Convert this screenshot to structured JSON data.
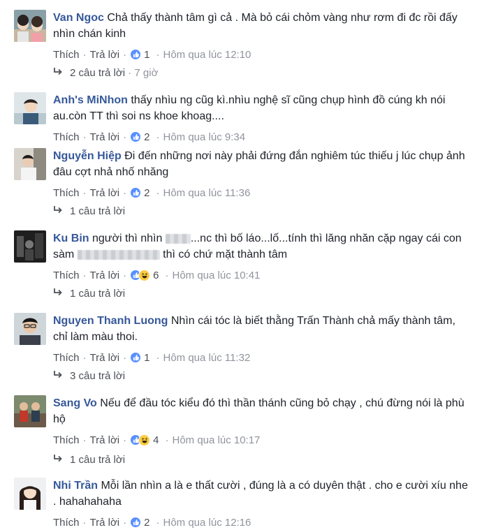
{
  "comments": [
    {
      "name": "Van Ngoc",
      "text_1": "Chả thấy thành tâm gì cả . Mà bỏ cái chỏm vàng như rơm đi đc rồi đấy nhìn chán kinh",
      "like": "Thích",
      "reply": "Trả lời",
      "reaction_count": "1",
      "time": "Hôm qua lúc 12:10",
      "replies_label": "2 câu trả lời",
      "replies_time": "7 giờ",
      "reactions": [
        "like-icon"
      ]
    },
    {
      "name": "Anh's MiNhon",
      "text_1": "thấy nhìu ng cũg kì.nhìu nghệ sĩ cũng chụp hình đồ cúng kh nói au.còn TT thì soi ns khoe khoag....",
      "like": "Thích",
      "reply": "Trả lời",
      "reaction_count": "2",
      "time": "Hôm qua lúc 9:34",
      "reactions": [
        "like-icon"
      ]
    },
    {
      "name": "Nguyễn Hiệp",
      "text_1": "Đi đến những nơi này phải đứng đắn nghiêm túc thiếu j lúc chụp ảnh đâu cợt nhả nhố nhăng",
      "like": "Thích",
      "reply": "Trả lời",
      "reaction_count": "2",
      "time": "Hôm qua lúc 11:36",
      "replies_label": "1 câu trả lời",
      "reactions": [
        "like-icon"
      ]
    },
    {
      "name": "Ku Bin",
      "text_1": "người thì nhìn",
      "text_2": "...nc thì bố láo...lố...tính thì lăng nhăn cặp ngay cái con sàm",
      "text_3": "thì có chứ mặt thành tâm",
      "like": "Thích",
      "reply": "Trả lời",
      "reaction_count": "6",
      "time": "Hôm qua lúc 10:41",
      "replies_label": "1 câu trả lời",
      "reactions": [
        "like-icon",
        "haha-icon"
      ]
    },
    {
      "name": "Nguyen Thanh Luong",
      "text_1": "Nhìn cái tóc là biết thằng Trấn Thành chả mấy thành tâm, chỉ làm màu thoi.",
      "like": "Thích",
      "reply": "Trả lời",
      "reaction_count": "1",
      "time": "Hôm qua lúc 11:32",
      "replies_label": "3 câu trả lời",
      "reactions": [
        "like-icon"
      ]
    },
    {
      "name": "Sang Vo",
      "text_1": "Nếu để đầu tóc kiểu đó thì thần thánh cũng bỏ chạy , chú đừng nói là phù hộ",
      "like": "Thích",
      "reply": "Trả lời",
      "reaction_count": "4",
      "time": "Hôm qua lúc 10:17",
      "replies_label": "1 câu trả lời",
      "reactions": [
        "like-icon",
        "haha-icon"
      ]
    },
    {
      "name": "Nhi Trần",
      "text_1": "Mỗi lần nhìn a là e thất cười , đúng là a có duyên thật . cho e cười xíu nhe . hahahahaha",
      "like": "Thích",
      "reply": "Trả lời",
      "reaction_count": "2",
      "time": "Hôm qua lúc 12:16",
      "reactions": [
        "like-icon"
      ]
    }
  ],
  "colors": {
    "name": "#365899",
    "meta": "#90949c",
    "like": "#5890ff",
    "haha": "#fbcd43"
  }
}
